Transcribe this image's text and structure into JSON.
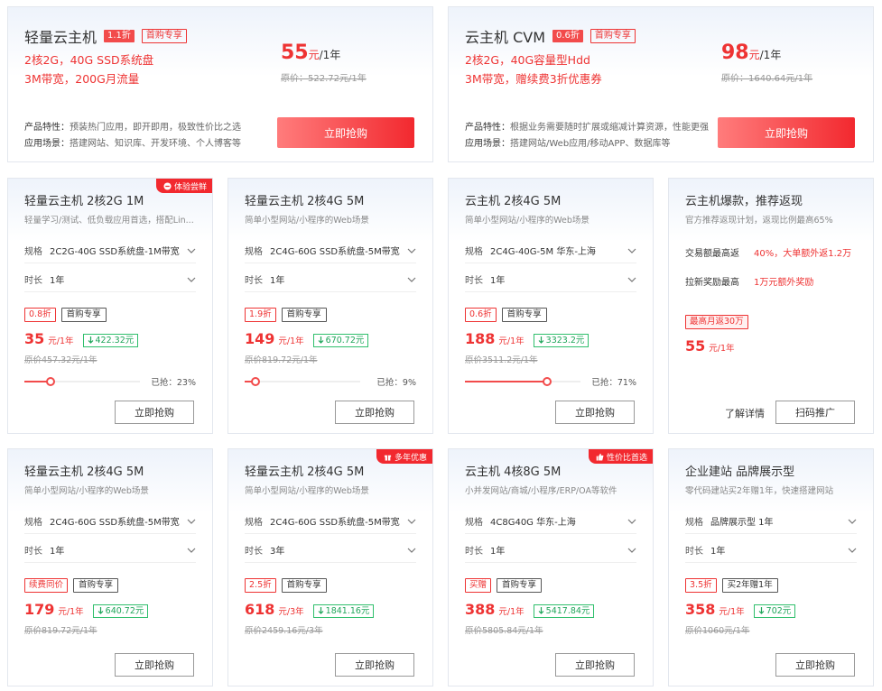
{
  "top": [
    {
      "title": "轻量云主机",
      "discount": "1.1折",
      "first": "首购专享",
      "desc1": "2核2G，40G SSD系统盘",
      "desc2": "3M带宽，200G月流量",
      "price": "55",
      "unit_a": "元",
      "unit_b": "/1年",
      "orig": "原价：522.72元/1年",
      "feat_k": "产品特性：",
      "feat_v": "预装热门应用，即开即用，极致性价比之选",
      "scene_k": "应用场景：",
      "scene_v": "搭建网站、知识库、开发环境、个人博客等",
      "buy": "立即抢购"
    },
    {
      "title": "云主机 CVM",
      "discount": "0.6折",
      "first": "首购专享",
      "desc1": "2核2G，40G容量型Hdd",
      "desc2": "3M带宽，赠续费3折优惠券",
      "price": "98",
      "unit_a": "元",
      "unit_b": "/1年",
      "orig": "原价：1640.64元/1年",
      "feat_k": "产品特性：",
      "feat_v": "根据业务需要随时扩展或缩减计算资源，性能更强",
      "scene_k": "应用场景：",
      "scene_v": "搭建网站/Web应用/移动APP、数据库等",
      "buy": "立即抢购"
    }
  ],
  "labels": {
    "spec": "规格",
    "duration": "时长",
    "buy": "立即抢购"
  },
  "cards": [
    {
      "ribbon": "体验尝鲜",
      "title": "轻量云主机 2核2G 1M",
      "sub": "轻量学习/测试、低负载应用首选，搭配Lin...",
      "spec": "2C2G-40G SSD系统盘-1M带宽",
      "duration": "1年",
      "tag1": "0.8折",
      "tag2": "首购专享",
      "price": "35",
      "unit": "元/1年",
      "saving": "422.32元",
      "orig": "原价457.32元/1年",
      "sold_label": "已抢：23%",
      "sold": 0.23
    },
    {
      "title": "轻量云主机 2核4G 5M",
      "sub": "简单小型网站/小程序的Web场景",
      "spec": "2C4G-60G SSD系统盘-5M带宽",
      "duration": "1年",
      "tag1": "1.9折",
      "tag2": "首购专享",
      "price": "149",
      "unit": "元/1年",
      "saving": "670.72元",
      "orig": "原价819.72元/1年",
      "sold_label": "已抢：9%",
      "sold": 0.09
    },
    {
      "title": "云主机 2核4G 5M",
      "sub": "简单小型网站/小程序的Web场景",
      "spec": "2C4G-40G-5M 华东-上海",
      "duration": "1年",
      "tag1": "0.6折",
      "tag2": "首购专享",
      "price": "188",
      "unit": "元/1年",
      "saving": "3323.2元",
      "orig": "原价3511.2元/1年",
      "sold_label": "已抢：71%",
      "sold": 0.71
    },
    {
      "ribbon": "多年优惠",
      "title": "轻量云主机 2核4G 5M",
      "sub": "简单小型网站/小程序的Web场景",
      "spec": "2C4G-60G SSD系统盘-5M带宽",
      "duration": "3年",
      "tag1": "2.5折",
      "tag2": "首购专享",
      "price": "618",
      "unit": "元/3年",
      "saving": "1841.16元",
      "orig": "原价2459.16元/3年"
    },
    {
      "ribbon": "性价比首选",
      "title": "云主机 4核8G 5M",
      "sub": "小并发网站/商城/小程序/ERP/OA等软件",
      "spec": "4C8G40G 华东-上海",
      "duration": "1年",
      "tag1": "买赠",
      "tag2": "首购专享",
      "price": "388",
      "unit": "元/1年",
      "saving": "5417.84元",
      "orig": "原价5805.84元/1年"
    },
    {
      "title": "企业建站 品牌展示型",
      "sub": "零代码建站买2年赠1年，快速搭建网站",
      "spec": "品牌展示型 1年",
      "duration": "1年",
      "tag1": "3.5折",
      "tag2": "买2年赠1年",
      "price": "358",
      "unit": "元/1年",
      "saving": "702元",
      "orig": "原价1060元/1年"
    },
    {
      "title": "轻量云主机 2核4G 5M",
      "sub": "简单小型网站/小程序的Web场景",
      "spec": "2C4G-60G SSD系统盘-5M带宽",
      "duration": "1年",
      "tag1": "续费同价",
      "tag2": "首购专享",
      "price": "179",
      "unit": "元/1年",
      "saving": "640.72元",
      "orig": "原价819.72元/1年"
    }
  ],
  "rebate": {
    "title": "云主机爆款，推荐返现",
    "sub": "官方推荐返现计划，返现比例最高65%",
    "r1_k": "交易额最高返",
    "r1_v": "40%，大单额外返1.2万",
    "r2_k": "拉新奖励最高",
    "r2_v": "1万元额外奖励",
    "tag": "最高月返30万",
    "price": "55",
    "unit": "元/1年",
    "detail": "了解详情",
    "scan": "扫码推广"
  },
  "colors": {
    "accent": "#f2292f",
    "saving": "#1fa55a"
  }
}
